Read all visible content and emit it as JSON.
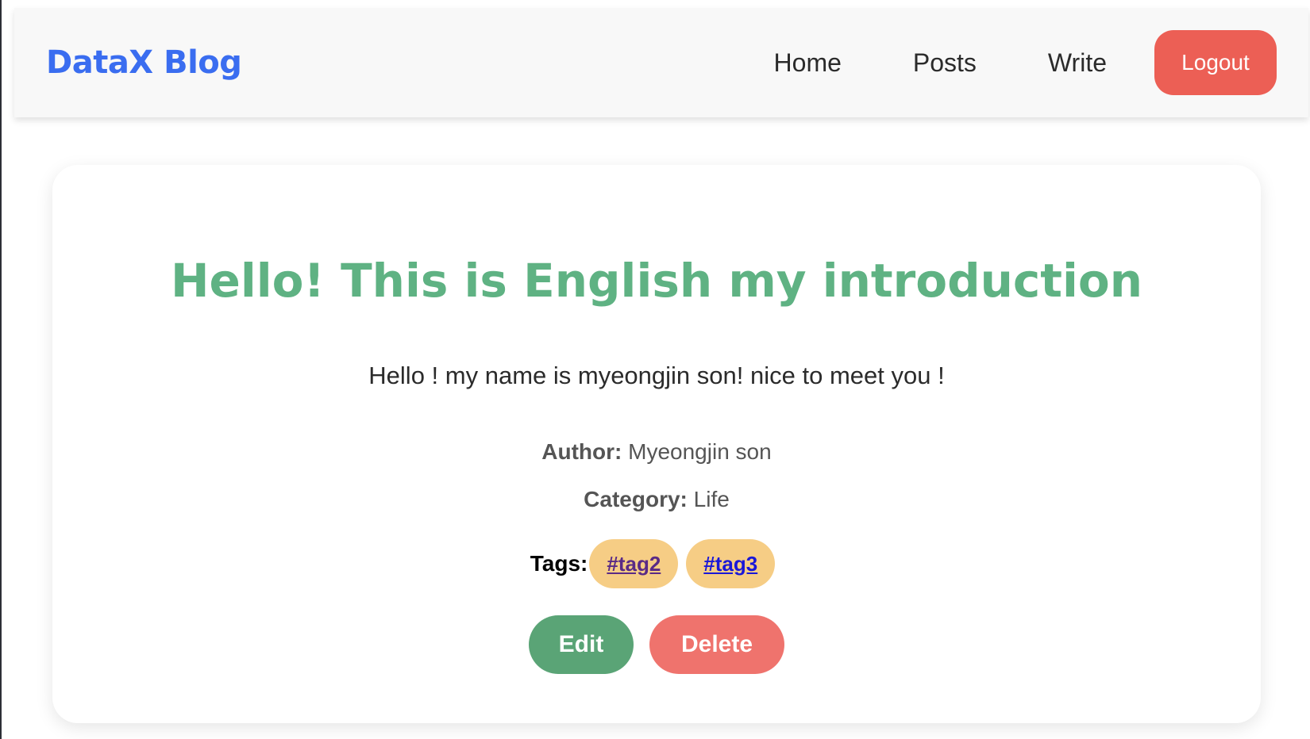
{
  "navbar": {
    "brand": "DataX Blog",
    "links": [
      {
        "label": "Home"
      },
      {
        "label": "Posts"
      },
      {
        "label": "Write"
      }
    ],
    "logout_label": "Logout"
  },
  "post": {
    "title": "Hello! This is English my introduction",
    "body": "Hello ! my name is myeongjin son! nice to meet you !",
    "author_label": "Author:",
    "author": "Myeongjin son",
    "category_label": "Category:",
    "category": "Life",
    "tags_label": "Tags:",
    "tags": [
      "#tag2",
      "#tag3"
    ],
    "edit_label": "Edit",
    "delete_label": "Delete"
  },
  "colors": {
    "brand": "#3a6df0",
    "title": "#5fb283",
    "logout": "#ec5f55",
    "tag_bg": "#f6cd85",
    "edit": "#5aa476",
    "delete": "#ef736d"
  }
}
